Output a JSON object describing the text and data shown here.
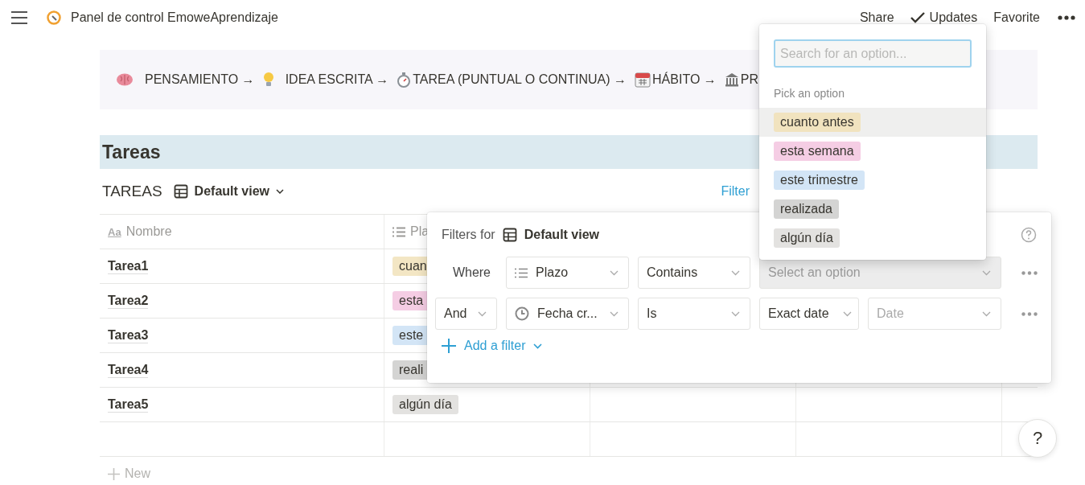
{
  "topbar": {
    "title": "Panel de control EmoweAprendizaje",
    "actions": [
      {
        "text": "Share",
        "kind": "plain"
      },
      {
        "text": "Updates",
        "kind": "check"
      },
      {
        "text": "Favorite",
        "kind": "plain"
      }
    ]
  },
  "callout": {
    "segments": [
      {
        "kind": "brain",
        "text": "PENSAMIENTO →"
      },
      {
        "kind": "bulb",
        "text": "IDEA ESCRITA →"
      },
      {
        "kind": "stopwatch",
        "text": "TAREA (PUNTUAL O CONTINUA) →"
      },
      {
        "kind": "calendar",
        "text": "HÁBITO →"
      },
      {
        "kind": "building",
        "text": "PR"
      }
    ]
  },
  "section_title": "Tareas",
  "database": {
    "title": "TAREAS",
    "view": "Default view",
    "filter_button": "Filter",
    "columns": [
      {
        "label": "Nombre",
        "kind": "title",
        "type_mark": "Aa"
      },
      {
        "label": "Pla",
        "kind": "select"
      }
    ],
    "rows": [
      {
        "name": "Tarea1",
        "tag": {
          "text": "cuan",
          "color": "#f3e6c4"
        }
      },
      {
        "name": "Tarea2",
        "tag": {
          "text": "esta",
          "color": "#f5cde4"
        }
      },
      {
        "name": "Tarea3",
        "tag": {
          "text": "este",
          "color": "#d3e5f6"
        }
      },
      {
        "name": "Tarea4",
        "tag": {
          "text": "reali",
          "color": "#d4d4d3"
        }
      },
      {
        "name": "Tarea5",
        "tag": {
          "text": "algún día",
          "color": "#e3e2e0"
        }
      }
    ],
    "new_row": "New"
  },
  "filter_panel": {
    "label": "Filters for",
    "view": "Default view",
    "rows": [
      {
        "conjunction": {
          "text": "Where",
          "kind": "label"
        },
        "property": {
          "text": "Plazo",
          "kind": "list"
        },
        "operator": "Contains",
        "values": [
          {
            "text": "Select an option",
            "kind": "active"
          }
        ]
      },
      {
        "conjunction": {
          "text": "And",
          "kind": "select"
        },
        "property": {
          "text": "Fecha cr...",
          "kind": "clock"
        },
        "operator": "Is",
        "values": [
          {
            "text": "Exact date",
            "kind": "select"
          },
          {
            "text": "Date",
            "kind": "placeholder"
          }
        ]
      }
    ],
    "add_filter": "Add a filter"
  },
  "option_menu": {
    "search": {
      "placeholder": "Search for an option..."
    },
    "heading": "Pick an option",
    "options": [
      {
        "text": "cuanto antes",
        "color": "#f1e3bf",
        "selected": true
      },
      {
        "text": "esta semana",
        "color": "#f5cde4",
        "selected": false
      },
      {
        "text": "este trimestre",
        "color": "#d3e5f6",
        "selected": false
      },
      {
        "text": "realizada",
        "color": "#d4d4d3",
        "selected": false
      },
      {
        "text": "algún día",
        "color": "#e3e2e0",
        "selected": false
      }
    ]
  },
  "help_button": "?"
}
